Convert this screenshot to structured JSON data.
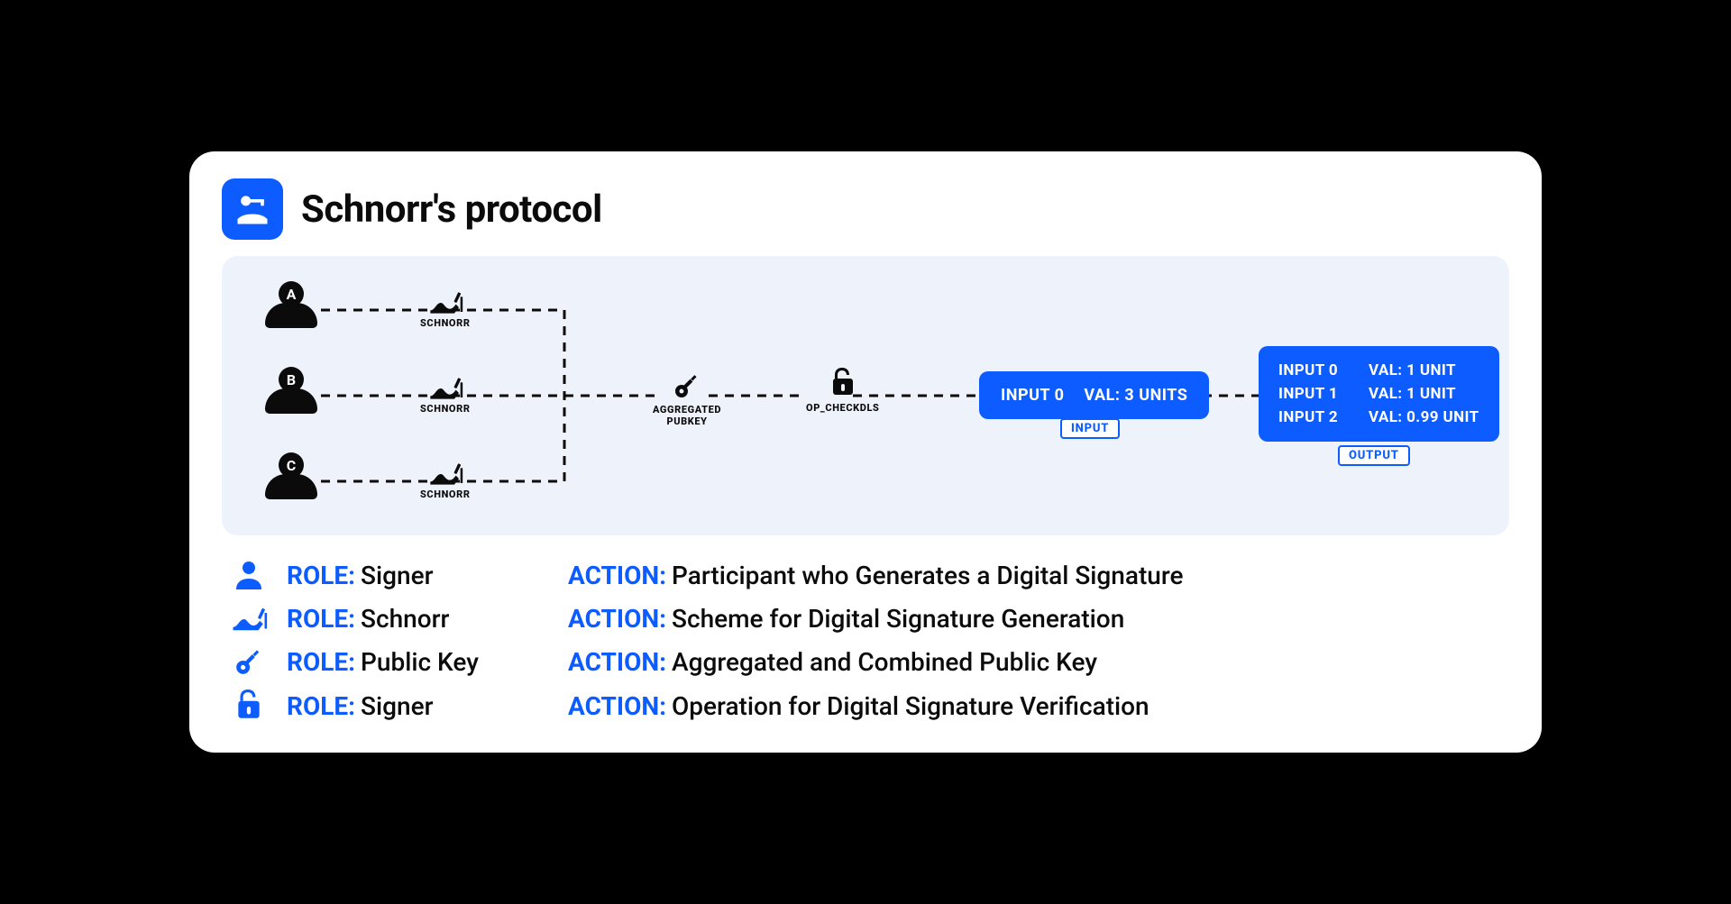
{
  "title": "Schnorr's protocol",
  "signers": [
    {
      "letter": "A",
      "label": "SCHNORR"
    },
    {
      "letter": "B",
      "label": "SCHNORR"
    },
    {
      "letter": "C",
      "label": "SCHNORR"
    }
  ],
  "stages": {
    "aggregated": "AGGREGATED\nPUBKEY",
    "checkdls": "OP_CHECKDLS"
  },
  "input": {
    "left": "INPUT 0",
    "right": "VAL: 3 UNITS",
    "tag": "INPUT"
  },
  "output": {
    "rows": [
      {
        "left": "INPUT 0",
        "right": "VAL: 1 UNIT"
      },
      {
        "left": "INPUT 1",
        "right": "VAL: 1 UNIT"
      },
      {
        "left": "INPUT 2",
        "right": "VAL: 0.99 UNIT"
      }
    ],
    "tag": "OUTPUT"
  },
  "legend": [
    {
      "icon": "person",
      "role": "Signer",
      "action": "Participant who Generates a Digital Signature"
    },
    {
      "icon": "sign",
      "role": "Schnorr",
      "action": "Scheme for Digital Signature Generation"
    },
    {
      "icon": "key",
      "role": "Public Key",
      "action": "Aggregated and Combined Public Key"
    },
    {
      "icon": "lock",
      "role": "Signer",
      "action": "Operation for Digital Signature Verification"
    }
  ],
  "labels": {
    "role": "ROLE:",
    "action": "ACTION:"
  }
}
